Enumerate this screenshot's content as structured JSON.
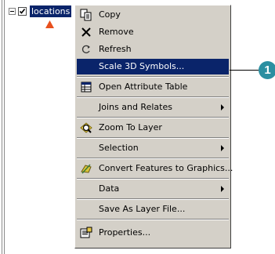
{
  "toc": {
    "layer_name": "locations",
    "checked": true,
    "expander": "minus"
  },
  "menu": {
    "items": [
      {
        "id": "copy",
        "label": "Copy",
        "icon": "copy-icon"
      },
      {
        "id": "remove",
        "label": "Remove",
        "icon": "remove-x-icon"
      },
      {
        "id": "refresh",
        "label": "Refresh",
        "icon": "refresh-icon"
      },
      {
        "id": "scale3d",
        "label": "Scale 3D Symbols...",
        "icon": "",
        "selected": true
      },
      {
        "id": "open_attr",
        "label": "Open Attribute Table",
        "icon": "table-icon"
      },
      {
        "id": "joins",
        "label": "Joins and Relates",
        "icon": "",
        "submenu": true
      },
      {
        "id": "zoom",
        "label": "Zoom To Layer",
        "icon": "zoom-to-layer-icon"
      },
      {
        "id": "selection",
        "label": "Selection",
        "icon": "",
        "submenu": true
      },
      {
        "id": "convert",
        "label": "Convert Features to Graphics...",
        "icon": "convert-graphics-icon"
      },
      {
        "id": "data",
        "label": "Data",
        "icon": "",
        "submenu": true
      },
      {
        "id": "save_layer",
        "label": "Save As Layer File...",
        "icon": ""
      },
      {
        "id": "properties",
        "label": "Properties...",
        "icon": "properties-icon"
      }
    ]
  },
  "callout": {
    "number": "1",
    "color": "#2b8fa1"
  },
  "colors": {
    "menu_bg": "#d4d0c8",
    "highlight": "#0a246a",
    "symbol": "#e8501e"
  }
}
